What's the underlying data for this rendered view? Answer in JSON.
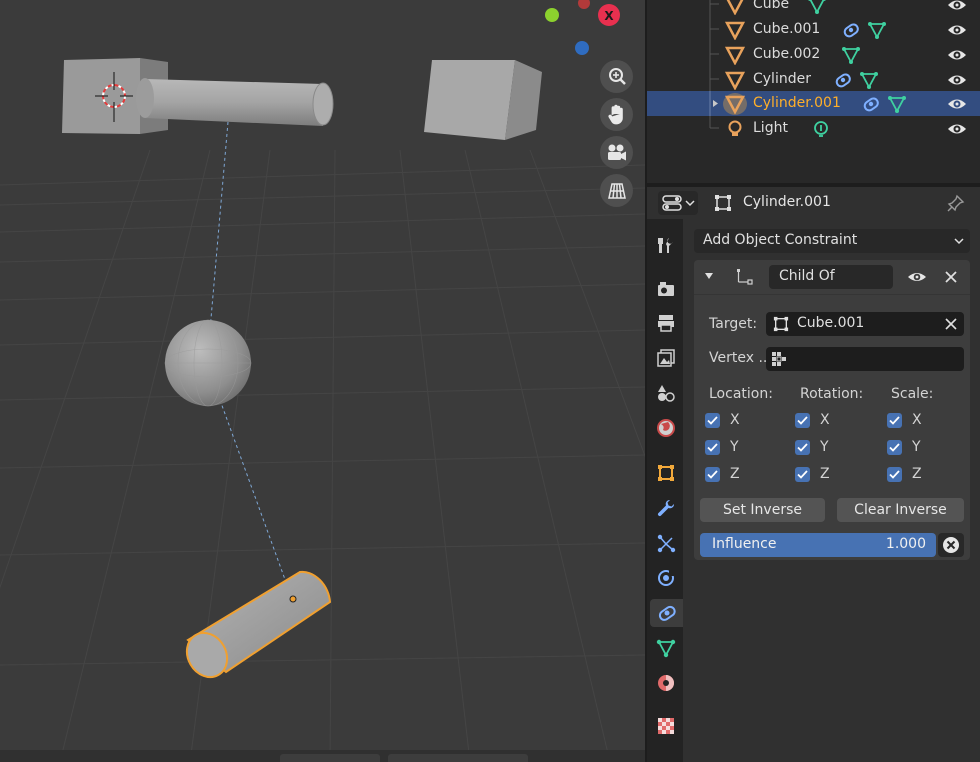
{
  "outliner": {
    "items": [
      {
        "label": "Cube",
        "type": "mesh"
      },
      {
        "label": "Cube.001",
        "type": "mesh"
      },
      {
        "label": "Cube.002",
        "type": "mesh"
      },
      {
        "label": "Cylinder",
        "type": "mesh"
      },
      {
        "label": "Cylinder.001",
        "type": "mesh",
        "selected": true
      },
      {
        "label": "Light",
        "type": "light"
      }
    ]
  },
  "gizmo": {
    "x_axis_label": "X"
  },
  "properties": {
    "object_name": "Cylinder.001",
    "add_constraint_label": "Add Object Constraint",
    "constraint": {
      "name": "Child Of",
      "target_label": "Target:",
      "target_value": "Cube.001",
      "vertex_group_label": "Vertex ..",
      "vertex_group_value": "",
      "location_label": "Location:",
      "rotation_label": "Rotation:",
      "scale_label": "Scale:",
      "axes": [
        "X",
        "Y",
        "Z"
      ],
      "location": [
        true,
        true,
        true
      ],
      "rotation": [
        true,
        true,
        true
      ],
      "scale": [
        true,
        true,
        true
      ],
      "set_inverse_label": "Set Inverse",
      "clear_inverse_label": "Clear Inverse",
      "influence_label": "Influence",
      "influence_value": "1.000"
    }
  },
  "colors": {
    "selected_row": "#334d80",
    "accent_blue": "#4772b3",
    "selection_orange": "#ffaf29",
    "mesh_icon": "#e8a25c",
    "constraint_icon": "#7fb0ff",
    "data_icon": "#3fd1a0"
  }
}
